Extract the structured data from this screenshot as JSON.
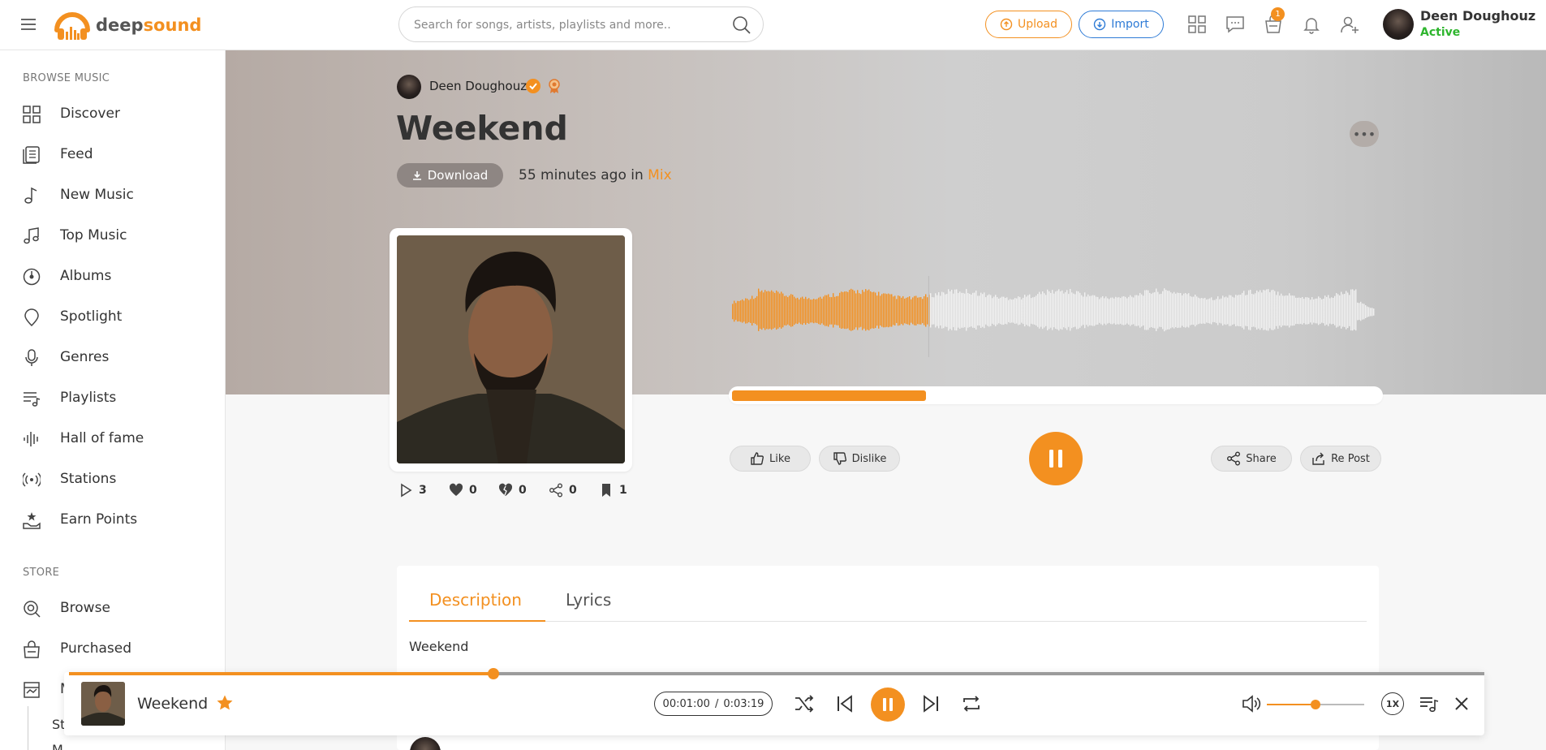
{
  "header": {
    "logo_deep": "deep",
    "logo_sound": "sound",
    "search_placeholder": "Search for songs, artists, playlists and more..",
    "upload_label": "Upload",
    "import_label": "Import",
    "cart_count": "1",
    "user_name": "Deen Doughouz",
    "user_status": "Active"
  },
  "sidebar": {
    "browse_section": "BROWSE MUSIC",
    "items": [
      {
        "label": "Discover"
      },
      {
        "label": "Feed"
      },
      {
        "label": "New Music"
      },
      {
        "label": "Top Music"
      },
      {
        "label": "Albums"
      },
      {
        "label": "Spotlight"
      },
      {
        "label": "Genres"
      },
      {
        "label": "Playlists"
      },
      {
        "label": "Hall of fame"
      },
      {
        "label": "Stations"
      },
      {
        "label": "Earn Points"
      }
    ],
    "store_section": "STORE",
    "store_items": [
      {
        "label": "Browse"
      },
      {
        "label": "Purchased"
      },
      {
        "label": "M"
      }
    ],
    "sub_items": [
      {
        "label": "St"
      },
      {
        "label": "M"
      }
    ]
  },
  "track": {
    "artist": "Deen Doughouz",
    "title": "Weekend",
    "download_label": "Download",
    "time_ago": "55 minutes ago in ",
    "genre": "Mix",
    "more_label": "•••",
    "progress_fraction": 0.3,
    "stats": {
      "plays": "3",
      "likes": "0",
      "dislikes": "0",
      "shares": "0",
      "saves": "1"
    },
    "like_label": "Like",
    "dislike_label": "Dislike",
    "share_label": "Share",
    "repost_label": "Re Post"
  },
  "tabs": {
    "description": "Description",
    "lyrics": "Lyrics",
    "description_text": "Weekend"
  },
  "player": {
    "title": "Weekend",
    "current_time": "00:01:00",
    "separator": "/",
    "total_time": "0:03:19",
    "progress_fraction": 0.3,
    "volume_fraction": 0.5,
    "speed_label": "1X"
  },
  "colors": {
    "accent": "#f39020",
    "import_blue": "#2e7bd6",
    "active_green": "#2db52d"
  }
}
